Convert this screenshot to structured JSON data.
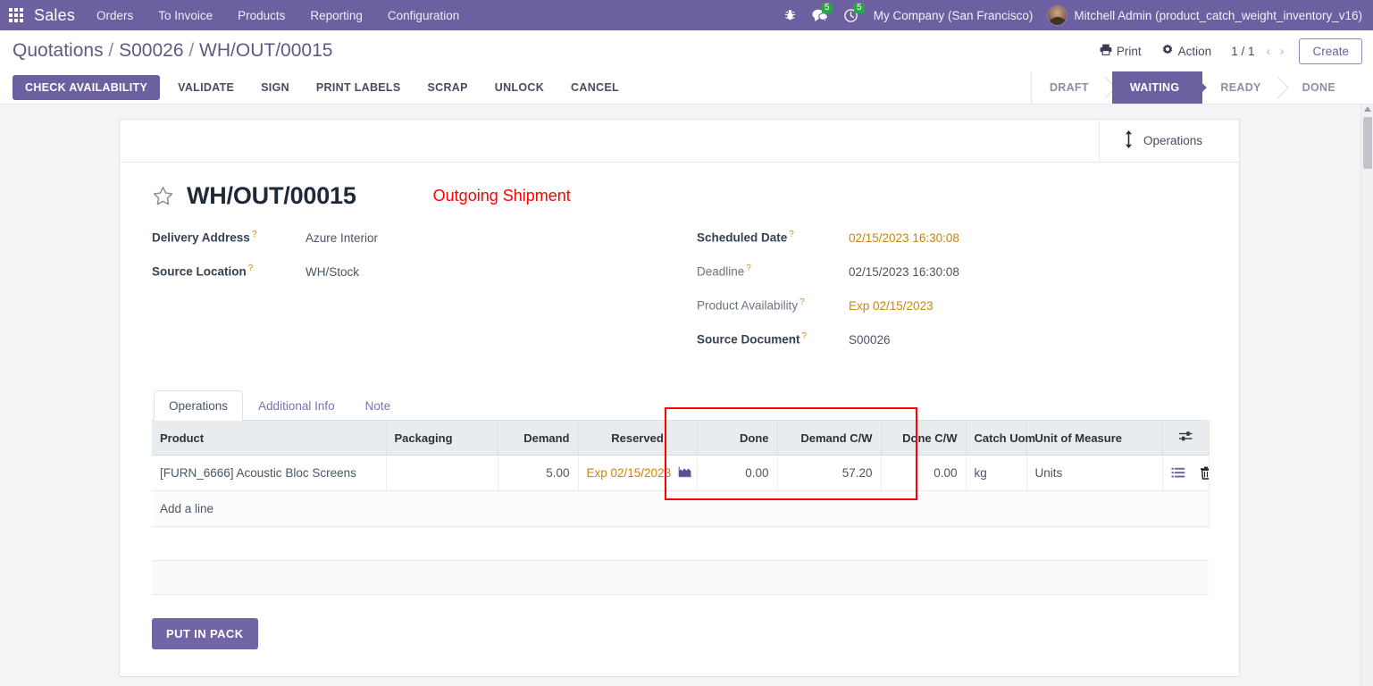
{
  "navbar": {
    "apps_icon": "apps-grid-icon",
    "brand": "Sales",
    "menus": [
      {
        "label": "Orders"
      },
      {
        "label": "To Invoice"
      },
      {
        "label": "Products"
      },
      {
        "label": "Reporting"
      },
      {
        "label": "Configuration"
      }
    ],
    "icons": [
      {
        "name": "bug-icon",
        "badge": null
      },
      {
        "name": "messages-icon",
        "badge": "5"
      },
      {
        "name": "activities-clock-icon",
        "badge": "5"
      }
    ],
    "company": "My Company (San Francisco)",
    "user": "Mitchell Admin (product_catch_weight_inventory_v16)"
  },
  "control_panel": {
    "breadcrumb": {
      "root": "Quotations",
      "sep1": "/",
      "parent": "S00026",
      "sep2": "/",
      "current": "WH/OUT/00015"
    },
    "print_label": "Print",
    "action_label": "Action",
    "pager": "1 / 1",
    "prev_arrow": "‹",
    "next_arrow": "›",
    "create_label": "Create",
    "buttons": [
      {
        "label": "CHECK AVAILABILITY",
        "primary": true
      },
      {
        "label": "VALIDATE",
        "primary": false
      },
      {
        "label": "SIGN",
        "primary": false
      },
      {
        "label": "PRINT LABELS",
        "primary": false
      },
      {
        "label": "SCRAP",
        "primary": false
      },
      {
        "label": "UNLOCK",
        "primary": false
      },
      {
        "label": "CANCEL",
        "primary": false
      }
    ],
    "statuses": [
      {
        "label": "DRAFT",
        "active": false
      },
      {
        "label": "WAITING",
        "active": true
      },
      {
        "label": "READY",
        "active": false
      },
      {
        "label": "DONE",
        "active": false
      }
    ]
  },
  "sheet": {
    "smart_button": {
      "label": "Operations",
      "icon": "arrows-vertical-icon"
    },
    "title": "WH/OUT/00015",
    "annotation": "Outgoing Shipment",
    "left_fields": [
      {
        "label": "Delivery Address",
        "help": "?",
        "value": "Azure Interior",
        "muted": false,
        "warn": false
      },
      {
        "label": "Source Location",
        "help": "?",
        "value": "WH/Stock",
        "muted": false,
        "warn": false
      }
    ],
    "right_fields": [
      {
        "label": "Scheduled Date",
        "help": "?",
        "value": "02/15/2023 16:30:08",
        "muted": false,
        "warn": true
      },
      {
        "label": "Deadline",
        "help": "?",
        "value": "02/15/2023 16:30:08",
        "muted": true,
        "warn": false
      },
      {
        "label": "Product Availability",
        "help": "?",
        "value": "Exp 02/15/2023",
        "muted": true,
        "warn": true
      },
      {
        "label": "Source Document",
        "help": "?",
        "value": "S00026",
        "muted": false,
        "warn": false
      }
    ],
    "tabs": [
      {
        "label": "Operations",
        "active": true
      },
      {
        "label": "Additional Info",
        "active": false
      },
      {
        "label": "Note",
        "active": false
      }
    ],
    "table": {
      "columns": [
        {
          "label": "Product",
          "align": "left"
        },
        {
          "label": "Packaging",
          "align": "left"
        },
        {
          "label": "Demand",
          "align": "right"
        },
        {
          "label": "Reserved",
          "align": "center"
        },
        {
          "label": "Done",
          "align": "right"
        },
        {
          "label": "Demand C/W",
          "align": "right"
        },
        {
          "label": "Done C/W",
          "align": "right"
        },
        {
          "label": "Catch Uom",
          "align": "left"
        },
        {
          "label": "Unit of Measure",
          "align": "left"
        },
        {
          "label": "",
          "align": "center"
        }
      ],
      "options_icon": "column-options-icon",
      "rows": [
        {
          "product": "[FURN_6666] Acoustic Bloc Screens",
          "packaging": "",
          "demand": "5.00",
          "reserved": "Exp 02/15/2023",
          "reserved_icon": "forecast-chart-icon",
          "done": "0.00",
          "demand_cw": "57.20",
          "done_cw": "0.00",
          "catch_uom": "kg",
          "uom": "Units",
          "actions": [
            "list-icon",
            "trash-icon"
          ]
        }
      ],
      "add_line_label": "Add a line"
    },
    "put_in_pack_label": "PUT IN PACK"
  },
  "colors": {
    "brand_purple": "#6c60a0",
    "annotation_red": "#ff0000",
    "warning_amber": "#c8860d",
    "badge_green": "#28a745"
  }
}
